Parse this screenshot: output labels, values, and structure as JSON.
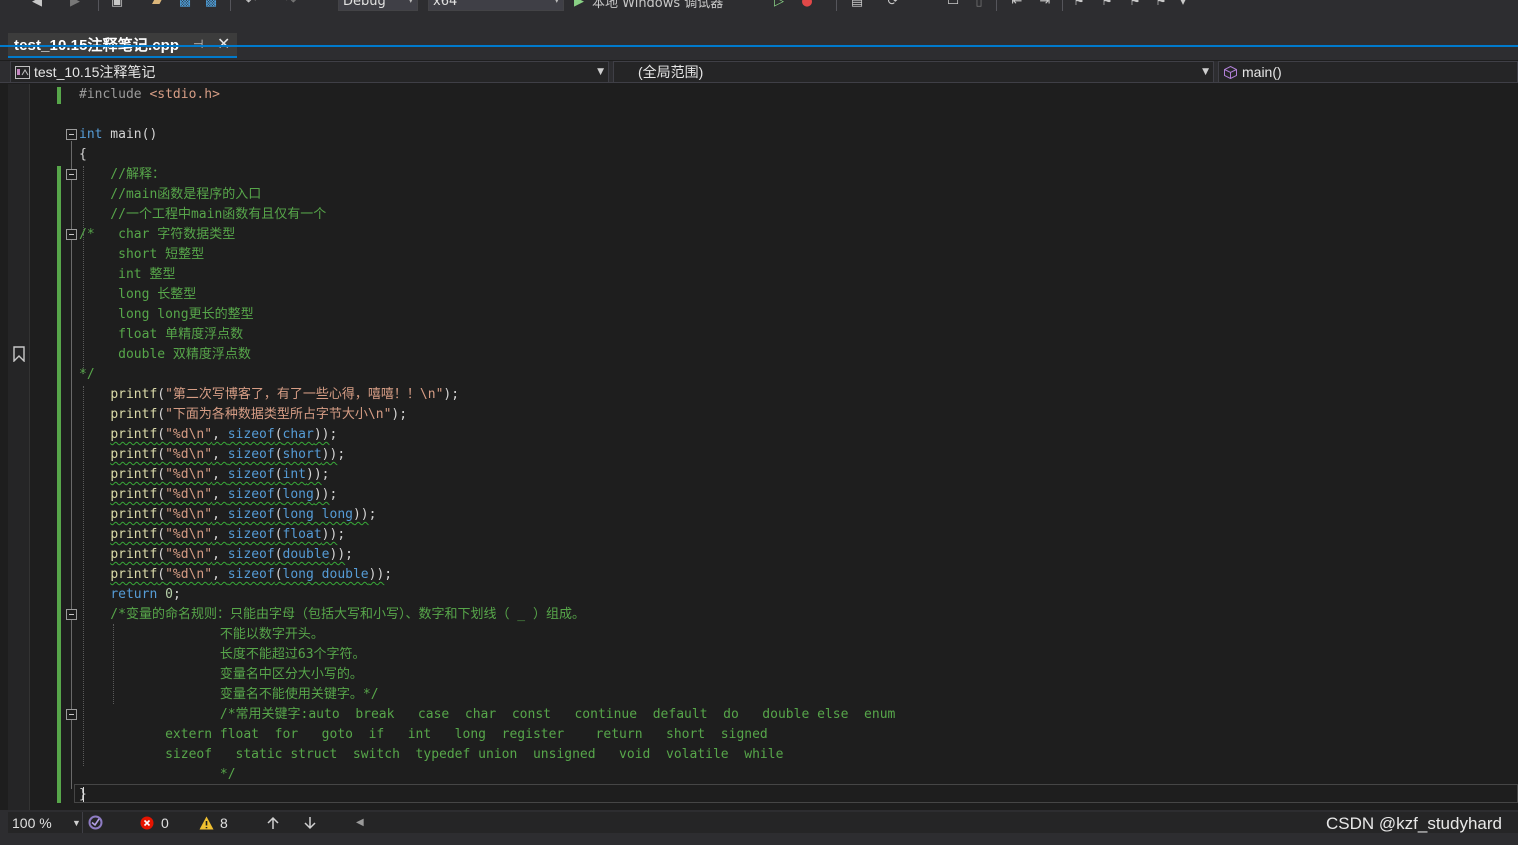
{
  "toolbar": {
    "config": "Debug",
    "platform": "x64",
    "debugger": "本地 Windows 调试器"
  },
  "tab": {
    "title": "test_10.15注释笔记.cpp",
    "pin": "⊣",
    "close": "✕"
  },
  "navbar": {
    "project": "test_10.15注释笔记",
    "scope": "(全局范围)",
    "member": "main()"
  },
  "code": {
    "lines": [
      [
        [
          "pp",
          "#include "
        ],
        [
          "inc",
          "<stdio.h>"
        ]
      ],
      [],
      [
        [
          "kw",
          "int"
        ],
        [
          "pl",
          " main()"
        ]
      ],
      [
        [
          "pl",
          "{"
        ]
      ],
      [
        [
          "cm",
          "    //解释："
        ]
      ],
      [
        [
          "cm",
          "    //main函数是程序的入口"
        ]
      ],
      [
        [
          "cm",
          "    //一个工程中main函数有且仅有一个"
        ]
      ],
      [
        [
          "cm",
          "/*   char 字符数据类型"
        ]
      ],
      [
        [
          "cm",
          "     short 短整型"
        ]
      ],
      [
        [
          "cm",
          "     int 整型"
        ]
      ],
      [
        [
          "cm",
          "     long 长整型"
        ]
      ],
      [
        [
          "cm",
          "     long long更长的整型"
        ]
      ],
      [
        [
          "cm",
          "     float 单精度浮点数"
        ]
      ],
      [
        [
          "cm",
          "     double 双精度浮点数"
        ]
      ],
      [
        [
          "cm",
          "*/"
        ]
      ],
      [
        [
          "pl",
          "    "
        ],
        [
          "fn",
          "printf"
        ],
        [
          "pl",
          "("
        ],
        [
          "str",
          "\"第二次写博客了，有了一些心得，嘻嘻！！\\n\""
        ],
        [
          "pl",
          ");"
        ]
      ],
      [
        [
          "pl",
          "    "
        ],
        [
          "fn",
          "printf"
        ],
        [
          "pl",
          "("
        ],
        [
          "str",
          "\"下面为各种数据类型所占字节大小\\n\""
        ],
        [
          "pl",
          ");"
        ]
      ],
      [
        [
          "pl",
          "    "
        ],
        [
          "fn sq",
          "printf"
        ],
        [
          "pl sq",
          "("
        ],
        [
          "str sq",
          "\"%d\\n\""
        ],
        [
          "pl sq",
          ", "
        ],
        [
          "kw sq",
          "sizeof"
        ],
        [
          "pl sq",
          "("
        ],
        [
          "kw sq",
          "char"
        ],
        [
          "pl sq",
          "))"
        ],
        [
          "pl",
          ";"
        ]
      ],
      [
        [
          "pl",
          "    "
        ],
        [
          "fn sq",
          "printf"
        ],
        [
          "pl sq",
          "("
        ],
        [
          "str sq",
          "\"%d\\n\""
        ],
        [
          "pl sq",
          ", "
        ],
        [
          "kw sq",
          "sizeof"
        ],
        [
          "pl sq",
          "("
        ],
        [
          "kw sq",
          "short"
        ],
        [
          "pl sq",
          "))"
        ],
        [
          "pl",
          ";"
        ]
      ],
      [
        [
          "pl",
          "    "
        ],
        [
          "fn sq",
          "printf"
        ],
        [
          "pl sq",
          "("
        ],
        [
          "str sq",
          "\"%d\\n\""
        ],
        [
          "pl sq",
          ", "
        ],
        [
          "kw sq",
          "sizeof"
        ],
        [
          "pl sq",
          "("
        ],
        [
          "kw sq",
          "int"
        ],
        [
          "pl sq",
          "))"
        ],
        [
          "pl",
          ";"
        ]
      ],
      [
        [
          "pl",
          "    "
        ],
        [
          "fn sq",
          "printf"
        ],
        [
          "pl sq",
          "("
        ],
        [
          "str sq",
          "\"%d\\n\""
        ],
        [
          "pl sq",
          ", "
        ],
        [
          "kw sq",
          "sizeof"
        ],
        [
          "pl sq",
          "("
        ],
        [
          "kw sq",
          "long"
        ],
        [
          "pl sq",
          "))"
        ],
        [
          "pl",
          ";"
        ]
      ],
      [
        [
          "pl",
          "    "
        ],
        [
          "fn sq",
          "printf"
        ],
        [
          "pl sq",
          "("
        ],
        [
          "str sq",
          "\"%d\\n\""
        ],
        [
          "pl sq",
          ", "
        ],
        [
          "kw sq",
          "sizeof"
        ],
        [
          "pl sq",
          "("
        ],
        [
          "kw sq",
          "long long"
        ],
        [
          "pl sq",
          "))"
        ],
        [
          "pl",
          ";"
        ]
      ],
      [
        [
          "pl",
          "    "
        ],
        [
          "fn sq",
          "printf"
        ],
        [
          "pl sq",
          "("
        ],
        [
          "str sq",
          "\"%d\\n\""
        ],
        [
          "pl sq",
          ", "
        ],
        [
          "kw sq",
          "sizeof"
        ],
        [
          "pl sq",
          "("
        ],
        [
          "kw sq",
          "float"
        ],
        [
          "pl sq",
          "))"
        ],
        [
          "pl",
          ";"
        ]
      ],
      [
        [
          "pl",
          "    "
        ],
        [
          "fn sq",
          "printf"
        ],
        [
          "pl sq",
          "("
        ],
        [
          "str sq",
          "\"%d\\n\""
        ],
        [
          "pl sq",
          ", "
        ],
        [
          "kw sq",
          "sizeof"
        ],
        [
          "pl sq",
          "("
        ],
        [
          "kw sq",
          "double"
        ],
        [
          "pl sq",
          "))"
        ],
        [
          "pl",
          ";"
        ]
      ],
      [
        [
          "pl",
          "    "
        ],
        [
          "fn sq",
          "printf"
        ],
        [
          "pl sq",
          "("
        ],
        [
          "str sq",
          "\"%d\\n\""
        ],
        [
          "pl sq",
          ", "
        ],
        [
          "kw sq",
          "sizeof"
        ],
        [
          "pl sq",
          "("
        ],
        [
          "kw sq",
          "long double"
        ],
        [
          "pl sq",
          "))"
        ],
        [
          "pl",
          ";"
        ]
      ],
      [
        [
          "pl",
          "    "
        ],
        [
          "kw",
          "return"
        ],
        [
          "pl",
          " "
        ],
        [
          "num",
          "0"
        ],
        [
          "pl",
          ";"
        ]
      ],
      [
        [
          "cm",
          "    /*变量的命名规则：只能由字母（包括大写和小写）、数字和下划线（ _ ）组成。"
        ]
      ],
      [
        [
          "cm",
          "                  不能以数字开头。"
        ]
      ],
      [
        [
          "cm",
          "                  长度不能超过63个字符。"
        ]
      ],
      [
        [
          "cm",
          "                  变量名中区分大小写的。"
        ]
      ],
      [
        [
          "cm",
          "                  变量名不能使用关键字。*/"
        ]
      ],
      [
        [
          "cm",
          "                  /*常用关键字:auto  break   case  char  const   continue  default  do   double else  enum"
        ]
      ],
      [
        [
          "cm",
          "           extern float  for   goto  if   int   long  register    return   short  signed"
        ]
      ],
      [
        [
          "cm",
          "           sizeof   static struct  switch  typedef union  unsigned   void  volatile  while"
        ]
      ],
      [
        [
          "cm",
          "                  */"
        ]
      ],
      [
        [
          "pl",
          "}"
        ]
      ]
    ]
  },
  "status": {
    "zoom": "100 %",
    "errors": "0",
    "warnings": "8"
  },
  "watermark": "CSDN @kzf_studyhard"
}
